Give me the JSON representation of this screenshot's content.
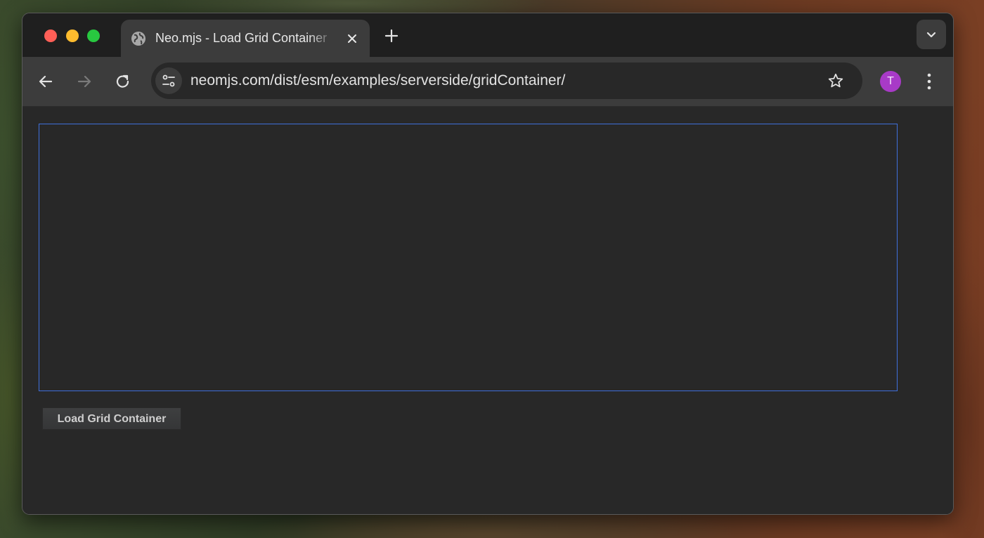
{
  "browser": {
    "tab": {
      "title": "Neo.mjs - Load Grid Container",
      "favicon_icon": "globe-icon",
      "close_icon": "close-icon"
    },
    "new_tab_icon": "plus-icon",
    "tab_search_icon": "chevron-down-icon",
    "traffic_lights": {
      "close_color": "#ff5f57",
      "minimize_color": "#febc2e",
      "zoom_color": "#28c840"
    },
    "toolbar": {
      "back_icon": "arrow-left-icon",
      "forward_icon": "arrow-right-icon",
      "reload_icon": "reload-icon",
      "site_info_icon": "tune-icon",
      "url": "neomjs.com/dist/esm/examples/serverside/gridContainer/",
      "bookmark_icon": "star-icon",
      "profile_initial": "T",
      "profile_color": "#a83ac7",
      "menu_icon": "more-vertical-icon"
    }
  },
  "page": {
    "grid_container_border_color": "#3f6fdc",
    "load_button_label": "Load Grid Container"
  }
}
